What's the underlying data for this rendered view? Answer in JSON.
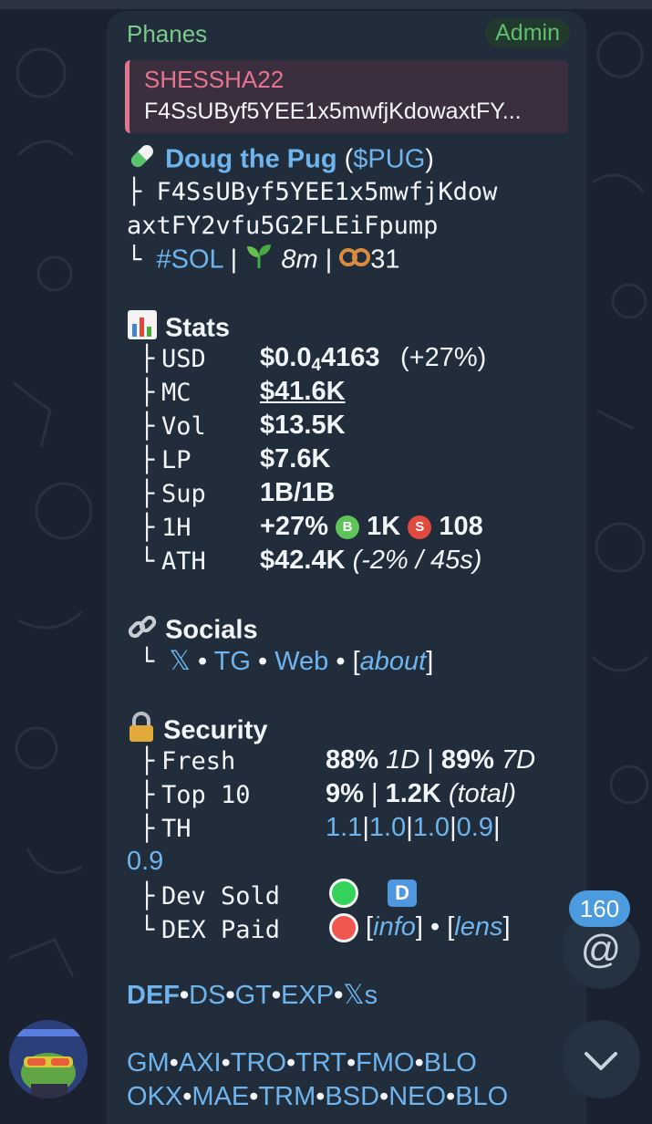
{
  "message": {
    "sender": "Phanes",
    "badge": "Admin",
    "reply": {
      "title": "SHESSHA22",
      "text": "F4SsUByf5YEE1x5mwfjKdowaxtFY..."
    },
    "token": {
      "name": "Doug the Pug",
      "ticker": "$PUG",
      "address_line1": "F4SsUByf5YEE1x5mwfjKdow",
      "address_line2": "axtFY2vfu5G2FLEiFpump",
      "chain": "#SOL",
      "age": "8m",
      "holders": "31"
    },
    "stats": {
      "title": "Stats",
      "usd_label": "USD",
      "usd_prefix": "$0.0",
      "usd_sub": "4",
      "usd_rest": "4163",
      "usd_change": "(+27%)",
      "mc_label": "MC",
      "mc": "$41.6K",
      "vol_label": "Vol",
      "vol": "$13.5K",
      "lp_label": "LP",
      "lp": "$7.6K",
      "sup_label": "Sup",
      "sup": "1B/1B",
      "h1_label": "1H",
      "h1_change": "+27%",
      "buy_letter": "B",
      "buys": "1K",
      "sell_letter": "S",
      "sells": "108",
      "ath_label": "ATH",
      "ath": "$42.4K",
      "ath_note": "(-2% / 45s)"
    },
    "socials": {
      "title": "Socials",
      "x": "𝕏",
      "tg": "TG",
      "web": "Web",
      "about": "about"
    },
    "security": {
      "title": "Security",
      "fresh_label": "Fresh",
      "fresh_1d": "88%",
      "fresh_1d_unit": "1D",
      "fresh_7d": "89%",
      "fresh_7d_unit": "7D",
      "top10_label": "Top 10",
      "top10": "9%",
      "top10_total": "1.2K",
      "top10_total_note": "(total)",
      "th_label": "TH",
      "th_values": [
        "1.1",
        "1.0",
        "1.0",
        "0.9",
        "0.9"
      ],
      "dev_sold_label": "Dev Sold",
      "dev_badge": "D",
      "dex_paid_label": "DEX Paid",
      "info": "info",
      "lens": "lens"
    },
    "links_row1": [
      "DEF",
      "DS",
      "GT",
      "EXP",
      "𝕏s"
    ],
    "links_row2": [
      "GM",
      "AXI",
      "TRO",
      "TRT",
      "FMO",
      "BLO"
    ],
    "links_row3": [
      "OKX",
      "MAE",
      "TRM",
      "BSD",
      "NEO",
      "BLO"
    ]
  },
  "overlay": {
    "mention_count": "160",
    "mention_icon": "@",
    "scroll_icon": "chevron-down"
  },
  "colors": {
    "bubble": "#212d3b",
    "link": "#6fb4ec",
    "sender": "#7cc98a",
    "reply_accent": "#e0758e",
    "badge": "#4d9bdf"
  }
}
